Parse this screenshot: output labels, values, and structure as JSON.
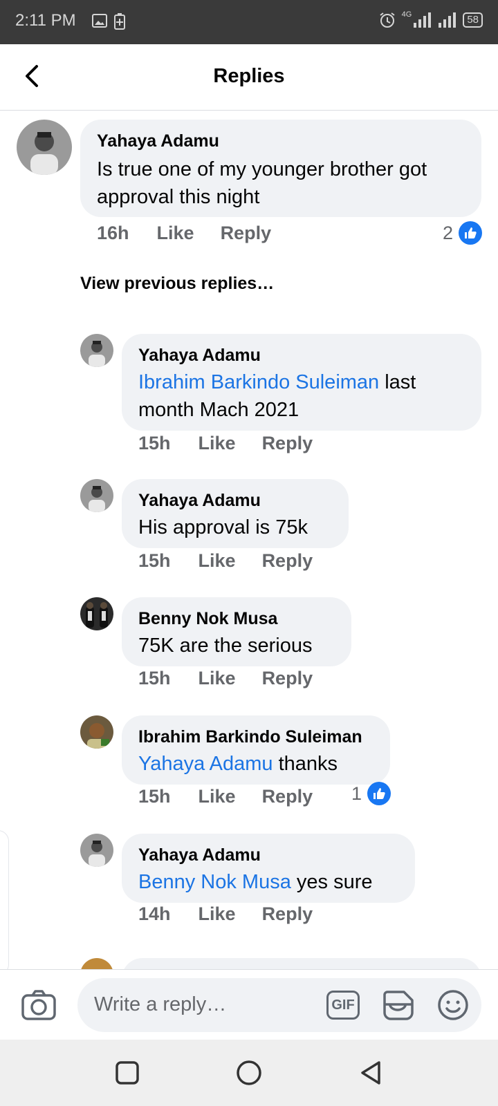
{
  "status_bar": {
    "time": "2:11 PM",
    "network": "4G",
    "battery": "58"
  },
  "header": {
    "title": "Replies"
  },
  "parent_comment": {
    "author": "Yahaya Adamu",
    "text": "Is true one of my younger brother got approval this night",
    "time": "16h",
    "like_label": "Like",
    "reply_label": "Reply",
    "reaction_count": "2"
  },
  "view_previous_label": "View previous replies…",
  "replies": [
    {
      "author": "Yahaya Adamu",
      "mention": "Ibrahim Barkindo Suleiman",
      "text_line1": " last",
      "text_line2": "month Mach 2021",
      "time": "15h",
      "like_label": "Like",
      "reply_label": "Reply"
    },
    {
      "author": "Yahaya Adamu",
      "text": "His approval is 75k",
      "time": "15h",
      "like_label": "Like",
      "reply_label": "Reply"
    },
    {
      "author": "Benny Nok Musa",
      "text": "75K are the serious",
      "time": "15h",
      "like_label": "Like",
      "reply_label": "Reply"
    },
    {
      "author": "Ibrahim Barkindo Suleiman",
      "mention": "Yahaya Adamu",
      "text": " thanks",
      "time": "15h",
      "like_label": "Like",
      "reply_label": "Reply",
      "reaction_count": "1"
    },
    {
      "author": "Yahaya Adamu",
      "mention": "Benny Nok Musa",
      "text": " yes sure",
      "time": "14h",
      "like_label": "Like",
      "reply_label": "Reply"
    }
  ],
  "composer": {
    "placeholder": "Write a reply…",
    "gif_label": "GIF"
  },
  "colors": {
    "accent": "#1877f2",
    "mention": "#1b74e4",
    "bubble": "#f0f2f5",
    "meta_text": "#65676b",
    "status_bar": "#3a3a3a"
  },
  "icons": [
    "back-arrow-icon",
    "thumbs-up-icon",
    "camera-icon",
    "gif-icon",
    "sticker-icon",
    "emoji-icon",
    "nav-square-icon",
    "nav-circle-icon",
    "nav-back-icon"
  ]
}
